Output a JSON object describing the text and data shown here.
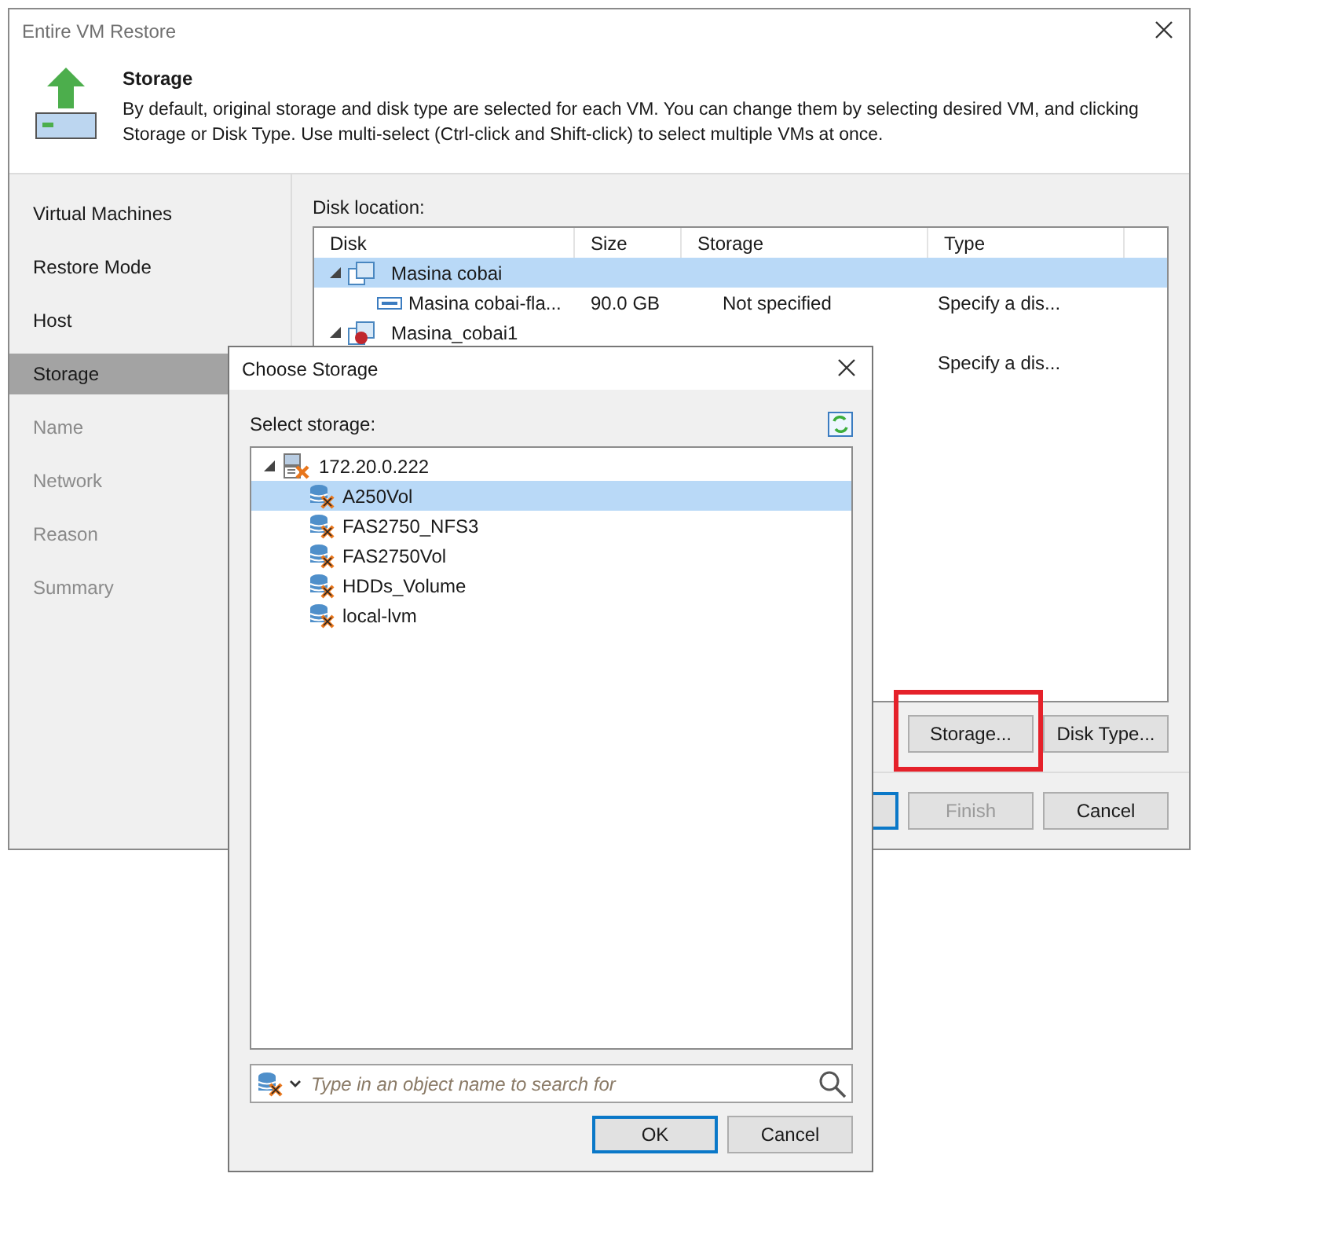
{
  "window": {
    "title": "Entire VM Restore"
  },
  "header": {
    "title": "Storage",
    "description": "By default, original storage and disk type are selected for each VM. You can change them by selecting desired VM, and clicking Storage or Disk Type. Use multi-select (Ctrl-click and Shift-click) to select multiple VMs at once."
  },
  "steps": [
    {
      "label": "Virtual Machines",
      "selected": false,
      "disabled": false
    },
    {
      "label": "Restore Mode",
      "selected": false,
      "disabled": false
    },
    {
      "label": "Host",
      "selected": false,
      "disabled": false
    },
    {
      "label": "Storage",
      "selected": true,
      "disabled": false
    },
    {
      "label": "Name",
      "selected": false,
      "disabled": true
    },
    {
      "label": "Network",
      "selected": false,
      "disabled": true
    },
    {
      "label": "Reason",
      "selected": false,
      "disabled": true
    },
    {
      "label": "Summary",
      "selected": false,
      "disabled": true
    }
  ],
  "disk_location": {
    "label": "Disk location:",
    "columns": [
      "Disk",
      "Size",
      "Storage",
      "Type"
    ],
    "rows": [
      {
        "kind": "vm",
        "disk": "Masina cobai",
        "expanded": true,
        "selected": true
      },
      {
        "kind": "disk",
        "disk": "Masina cobai-fla...",
        "size": "90.0 GB",
        "storage": "Not specified",
        "type": "Specify a dis...",
        "selected": false
      },
      {
        "kind": "vm-warning",
        "disk": "Masina_cobai1",
        "expanded": true,
        "selected": false
      },
      {
        "kind": "disk",
        "type": "Specify a dis...",
        "selected": false
      }
    ]
  },
  "action_buttons": [
    {
      "label": "Storage...",
      "highlighted": true
    },
    {
      "label": "Disk Type...",
      "highlighted": false
    }
  ],
  "footer_buttons": [
    {
      "default": true,
      "disabled": false
    },
    {
      "label": "Finish",
      "default": false,
      "disabled": true
    },
    {
      "label": "Cancel",
      "default": false,
      "disabled": false
    }
  ],
  "dialog": {
    "title": "Choose Storage",
    "label": "Select storage:",
    "tree": [
      {
        "kind": "host",
        "label": "172.20.0.222",
        "expanded": true,
        "selected": false,
        "children": [
          {
            "kind": "datastore",
            "label": "A250Vol",
            "selected": true
          },
          {
            "kind": "datastore",
            "label": "FAS2750_NFS3",
            "selected": false
          },
          {
            "kind": "datastore",
            "label": "FAS2750Vol",
            "selected": false
          },
          {
            "kind": "datastore",
            "label": "HDDs_Volume",
            "selected": false
          },
          {
            "kind": "datastore",
            "label": "local-lvm",
            "selected": false
          }
        ]
      }
    ],
    "search": {
      "placeholder": "Type in an object name to search for"
    },
    "buttons": [
      {
        "label": "OK",
        "default": true
      },
      {
        "label": "Cancel",
        "default": false
      }
    ]
  }
}
